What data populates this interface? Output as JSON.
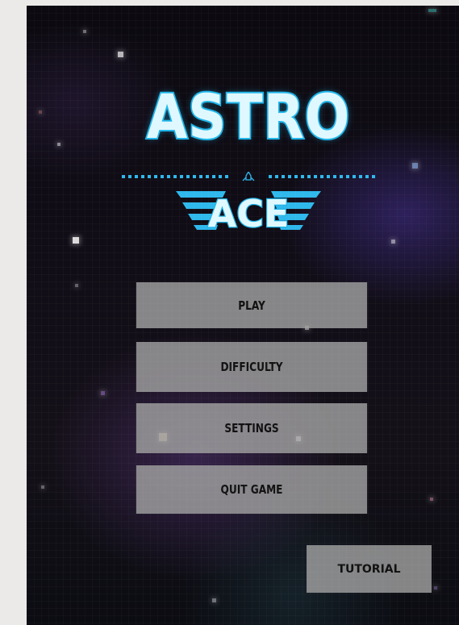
{
  "logo": {
    "title": "ASTRO",
    "subtitle": "ACE",
    "title_color": "#dff8ff",
    "accent_color": "#1fb3e8",
    "emblem_icon": "rocket-icon"
  },
  "menu": {
    "items": [
      {
        "id": "play",
        "label": "PLAY"
      },
      {
        "id": "difficulty",
        "label": "DIFFICULTY"
      },
      {
        "id": "settings",
        "label": "SETTINGS"
      },
      {
        "id": "quit",
        "label": "QUIT GAME"
      }
    ],
    "button_color": "#a0a0a0"
  },
  "tutorial": {
    "label": "TUTORIAL"
  }
}
